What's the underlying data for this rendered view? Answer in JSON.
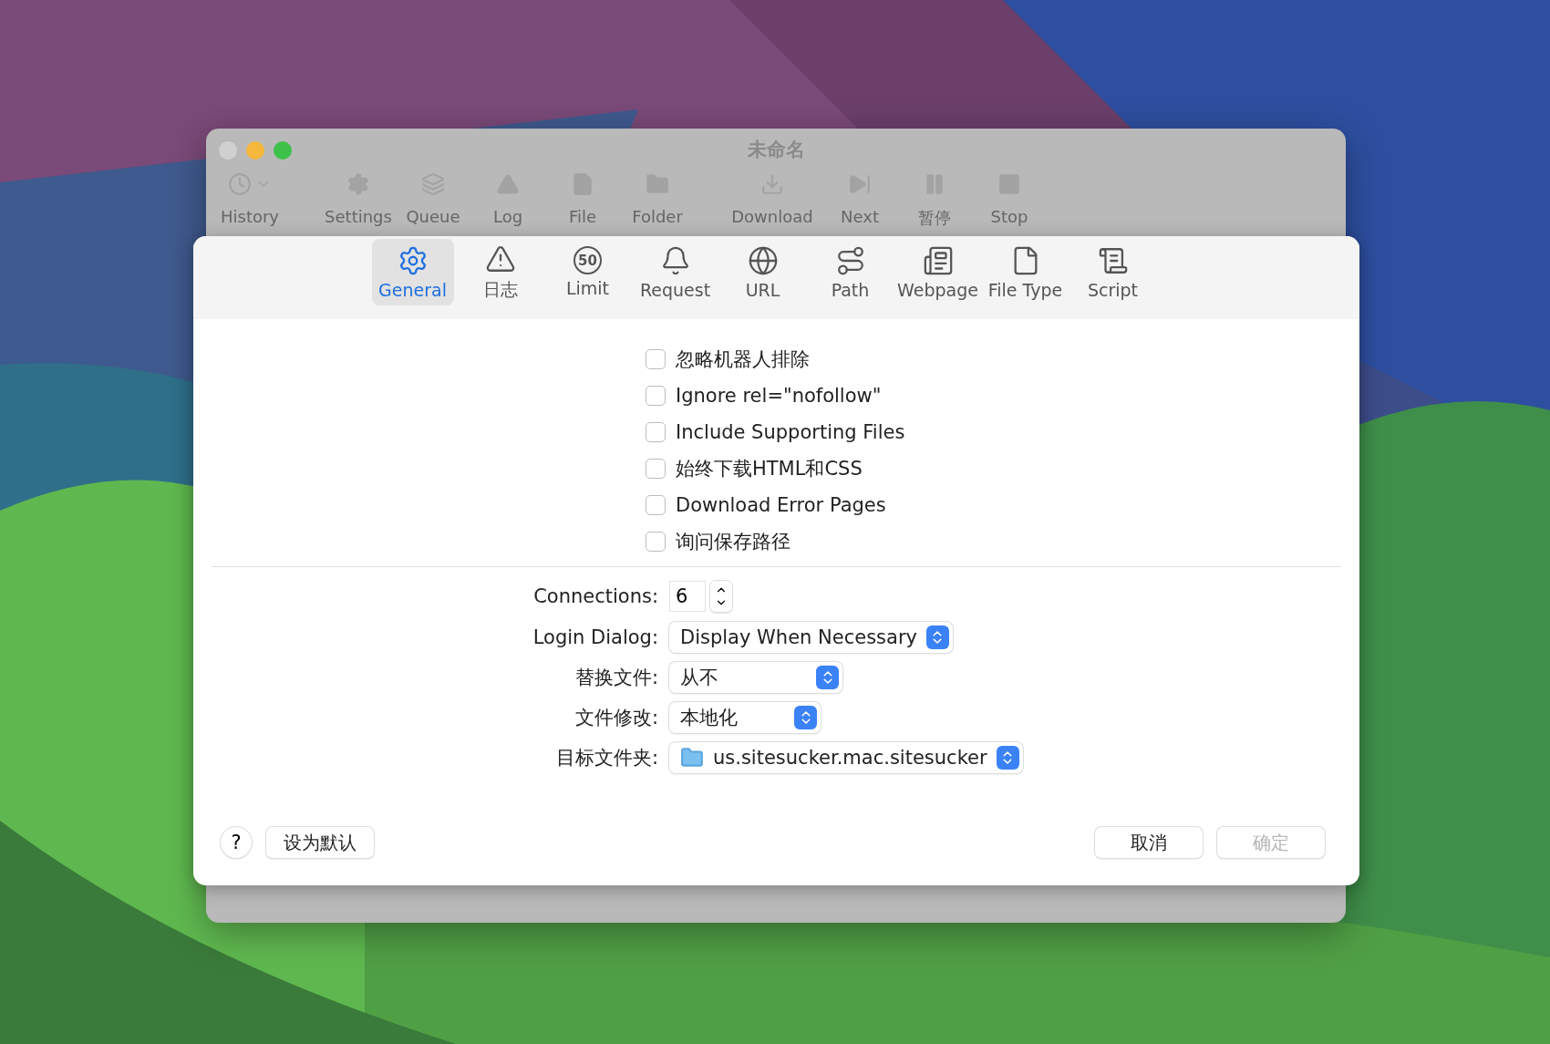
{
  "window": {
    "title": "未命名"
  },
  "toolbar": [
    {
      "label": "History"
    },
    {
      "label": "Settings"
    },
    {
      "label": "Queue"
    },
    {
      "label": "Log"
    },
    {
      "label": "File"
    },
    {
      "label": "Folder"
    },
    {
      "label": "Download"
    },
    {
      "label": "Next"
    },
    {
      "label": "暂停"
    },
    {
      "label": "Stop"
    }
  ],
  "tabs": [
    {
      "label": "General",
      "selected": true
    },
    {
      "label": "日志",
      "selected": false
    },
    {
      "label": "Limit",
      "selected": false,
      "badge": "50"
    },
    {
      "label": "Request",
      "selected": false
    },
    {
      "label": "URL",
      "selected": false
    },
    {
      "label": "Path",
      "selected": false
    },
    {
      "label": "Webpage",
      "selected": false
    },
    {
      "label": "File Type",
      "selected": false
    },
    {
      "label": "Script",
      "selected": false
    }
  ],
  "options": [
    {
      "label": "忽略机器人排除",
      "checked": false
    },
    {
      "label": "Ignore rel=\"nofollow\"",
      "checked": false
    },
    {
      "label": "Include Supporting Files",
      "checked": false
    },
    {
      "label": "始终下载HTML和CSS",
      "checked": false
    },
    {
      "label": "Download Error Pages",
      "checked": false
    },
    {
      "label": "询问保存路径",
      "checked": false
    }
  ],
  "fields": [
    {
      "kind": "stepper",
      "label": "Connections:",
      "value": "6"
    },
    {
      "kind": "select",
      "label": "Login Dialog:",
      "value": "Display When Necessary"
    },
    {
      "kind": "select",
      "label": "替换文件:",
      "value": "从不"
    },
    {
      "kind": "select",
      "label": "文件修改:",
      "value": "本地化"
    },
    {
      "kind": "folder",
      "label": "目标文件夹:",
      "value": "us.sitesucker.mac.sitesucker"
    }
  ],
  "help_button": "?",
  "buttons_left": [
    {
      "label": "设为默认",
      "disabled": false
    }
  ],
  "buttons_right": [
    {
      "label": "取消",
      "disabled": false
    },
    {
      "label": "确定",
      "disabled": true
    }
  ]
}
